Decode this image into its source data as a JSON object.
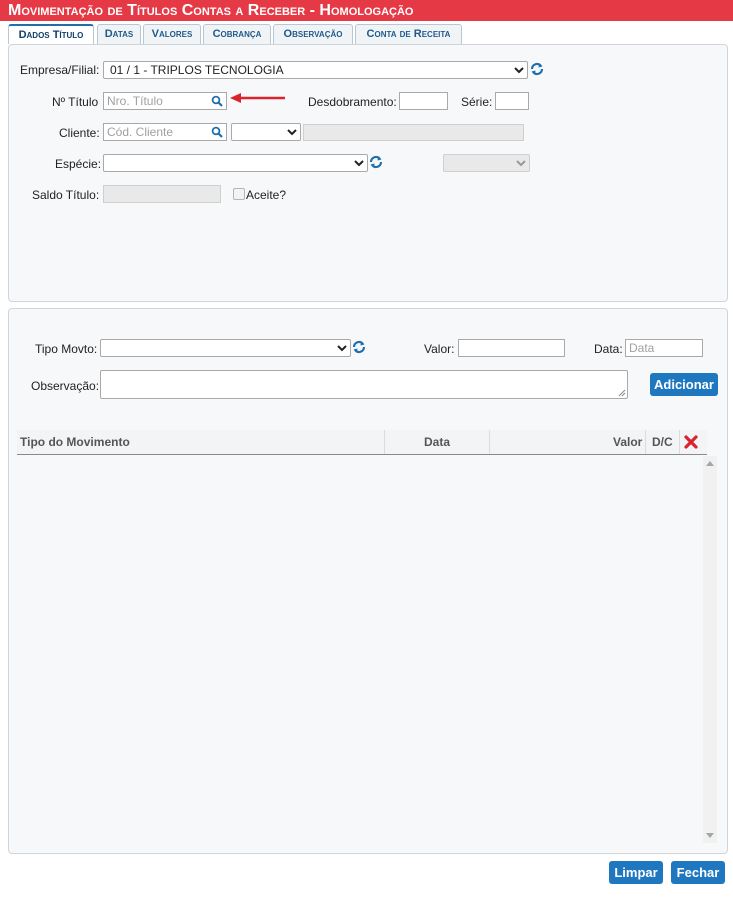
{
  "window": {
    "title": "Movimentação de Títulos Contas a Receber  - Homologação"
  },
  "tabs": [
    {
      "label": "Dados Título",
      "active": true
    },
    {
      "label": "Datas"
    },
    {
      "label": "Valores"
    },
    {
      "label": "Cobrança"
    },
    {
      "label": "Observação"
    },
    {
      "label": "Conta de Receita"
    }
  ],
  "form": {
    "empresa_label": "Empresa/Filial:",
    "empresa_value": "01 / 1 - TRIPLOS TECNOLOGIA",
    "titulo_label": "Nº Título",
    "titulo_placeholder": "Nro. Título",
    "desdobramento_label": "Desdobramento:",
    "serie_label": "Série:",
    "cliente_label": "Cliente:",
    "cliente_placeholder": "Cód. Cliente",
    "especie_label": "Espécie:",
    "saldo_label": "Saldo Título:",
    "aceite_label": "Aceite?"
  },
  "movimento": {
    "tipo_label": "Tipo Movto:",
    "valor_label": "Valor:",
    "data_label": "Data:",
    "data_placeholder": "Data",
    "obs_label": "Observação:",
    "add_button": "Adicionar"
  },
  "table": {
    "columns": [
      "Tipo do Movimento",
      "Data",
      "Valor",
      "D/C"
    ],
    "rows": []
  },
  "footer": {
    "limpar": "Limpar",
    "fechar": "Fechar"
  },
  "colors": {
    "title_bg": "#e63946",
    "button_bg": "#1f77c0",
    "arrow": "#d9232d",
    "icon_blue": "#1f6fad"
  },
  "icons": [
    "search-icon",
    "refresh-icon",
    "chevron-down-icon",
    "delete-x-icon",
    "arrow-annotation"
  ]
}
